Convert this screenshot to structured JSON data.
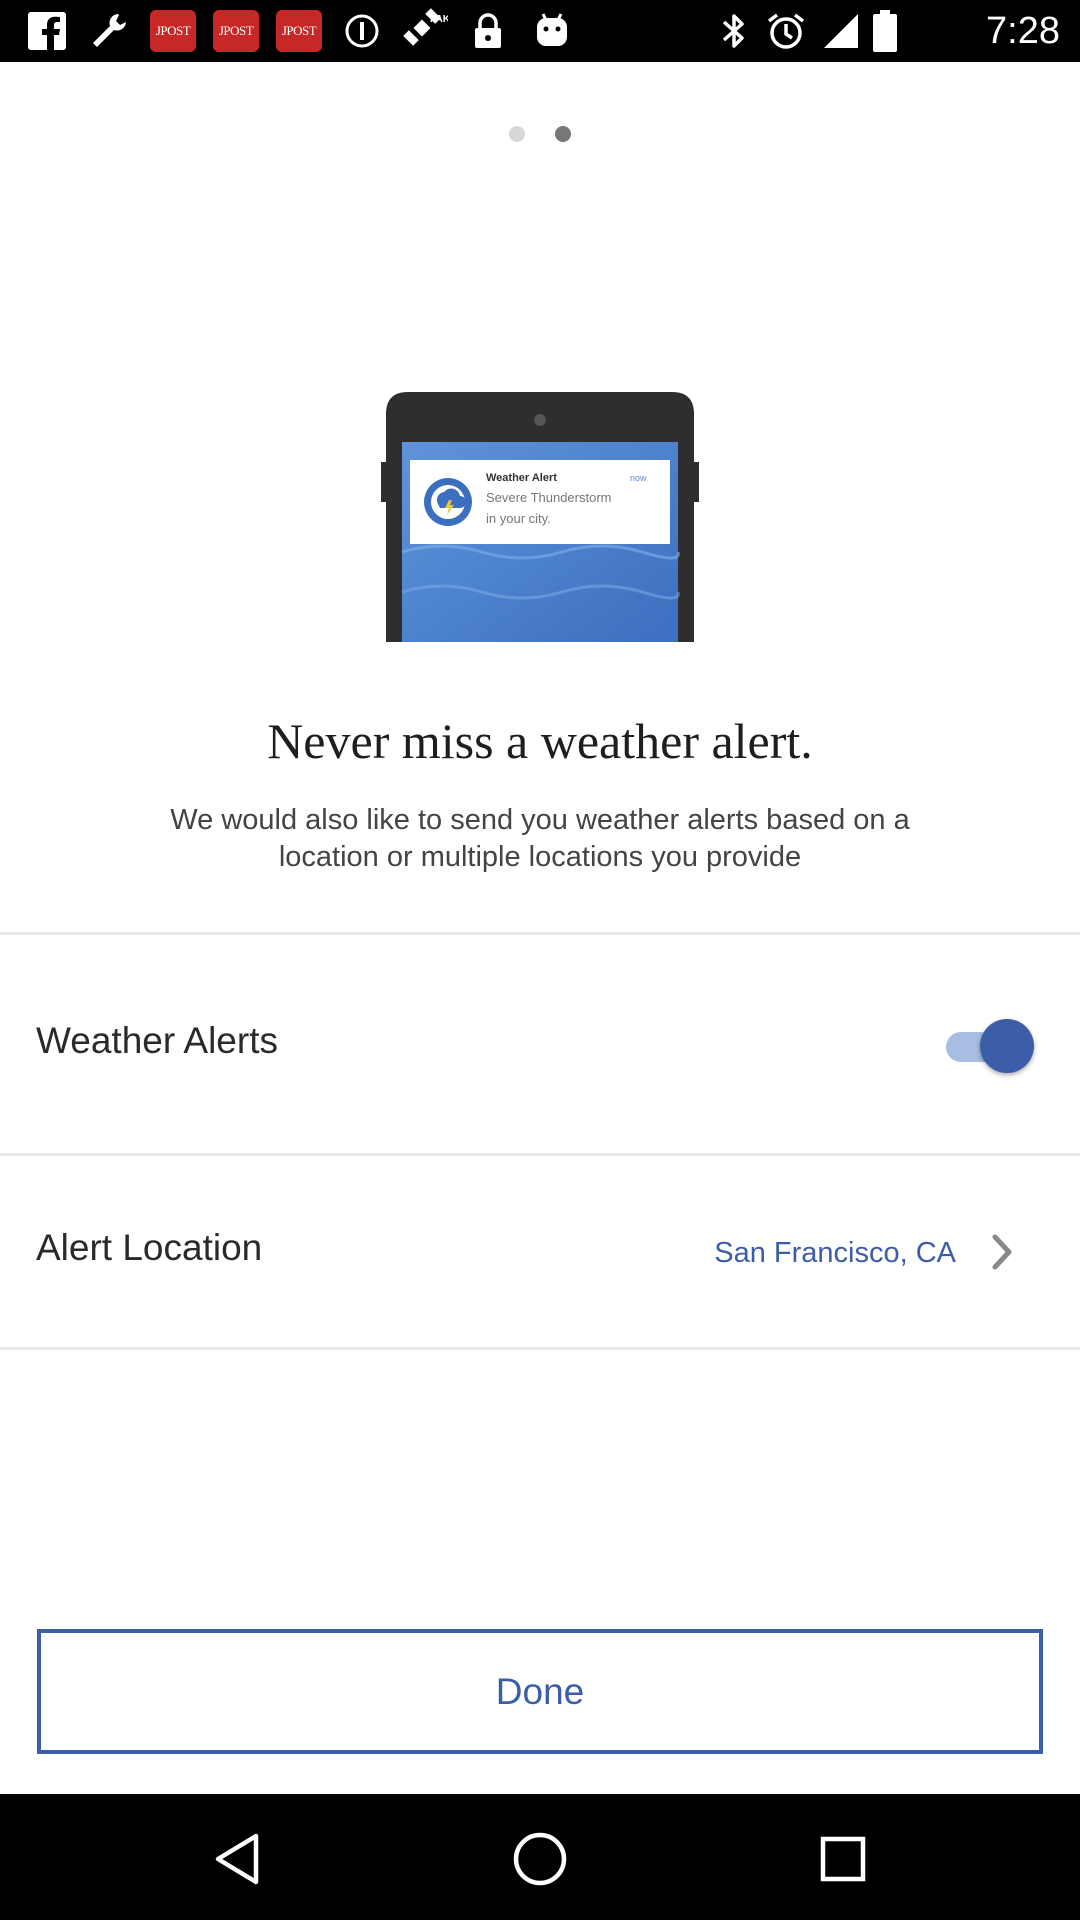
{
  "status_bar": {
    "time": "7:28",
    "jpost_label": "JPOST",
    "icons_left": [
      "facebook-icon",
      "wrench-icon",
      "jpost-icon",
      "jpost-icon",
      "jpost-icon",
      "info-icon",
      "satellite-fake-gps-icon",
      "lock-icon",
      "android-icon"
    ],
    "icons_right": [
      "bluetooth-icon",
      "alarm-icon",
      "signal-icon",
      "battery-icon"
    ]
  },
  "pager": {
    "count": 2,
    "active_index": 1
  },
  "illustration": {
    "notification_title": "Weather Alert",
    "notification_time": "now",
    "notification_body_line1": "Severe Thunderstorm",
    "notification_body_line2": "in your city."
  },
  "headline": "Never miss a weather alert.",
  "subtext": "We would also like to send you weather alerts based on a location or multiple locations you provide",
  "settings": {
    "weather_alerts": {
      "label": "Weather Alerts",
      "enabled": true
    },
    "alert_location": {
      "label": "Alert Location",
      "value": "San Francisco, CA"
    }
  },
  "done_label": "Done",
  "colors": {
    "accent": "#3c5ea9",
    "toggle_track": "#a7bde2",
    "divider": "#e7e7e7",
    "text_primary": "#2a2a2a",
    "text_secondary": "#444444"
  },
  "nav": [
    "back-icon",
    "home-icon",
    "recents-icon"
  ]
}
